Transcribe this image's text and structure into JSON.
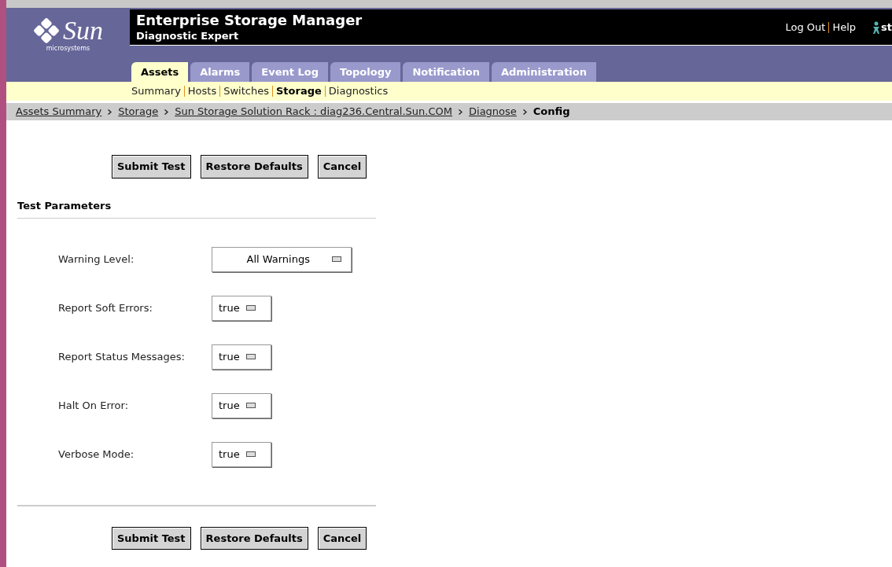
{
  "header": {
    "logo_word": "Sun",
    "logo_sub": "microsystems",
    "title": "Enterprise Storage Manager",
    "subtitle": "Diagnostic Expert",
    "links": [
      "Log Out",
      "Help"
    ],
    "user": "st"
  },
  "tabs": [
    {
      "label": "Assets",
      "selected": true
    },
    {
      "label": "Alarms",
      "selected": false
    },
    {
      "label": "Event Log",
      "selected": false
    },
    {
      "label": "Topology",
      "selected": false
    },
    {
      "label": "Notification",
      "selected": false
    },
    {
      "label": "Administration",
      "selected": false
    }
  ],
  "subnav": [
    {
      "label": "Summary",
      "selected": false
    },
    {
      "label": "Hosts",
      "selected": false
    },
    {
      "label": "Switches",
      "selected": false
    },
    {
      "label": "Storage",
      "selected": true
    },
    {
      "label": "Diagnostics",
      "selected": false
    }
  ],
  "breadcrumb": [
    {
      "label": "Assets Summary",
      "kind": "link"
    },
    {
      "label": "Storage",
      "kind": "link"
    },
    {
      "label": "Sun Storage Solution Rack : diag236.Central.Sun.COM",
      "kind": "link"
    },
    {
      "label": "Diagnose",
      "kind": "link"
    },
    {
      "label": "Config",
      "kind": "current"
    }
  ],
  "top_buttons": [
    "Submit Test",
    "Restore Defaults",
    "Cancel"
  ],
  "section_title": "Test Parameters",
  "parameters": [
    {
      "label": "Warning Level:",
      "value": "All Warnings",
      "kind": "wide"
    },
    {
      "label": "Report Soft Errors:",
      "value": "true",
      "kind": "narrow"
    },
    {
      "label": "Report Status Messages:",
      "value": "true",
      "kind": "narrow"
    },
    {
      "label": "Halt On Error:",
      "value": "true",
      "kind": "narrow"
    },
    {
      "label": "Verbose Mode:",
      "value": "true",
      "kind": "narrow"
    }
  ],
  "bottom_buttons": [
    "Submit Test",
    "Restore Defaults",
    "Cancel"
  ]
}
